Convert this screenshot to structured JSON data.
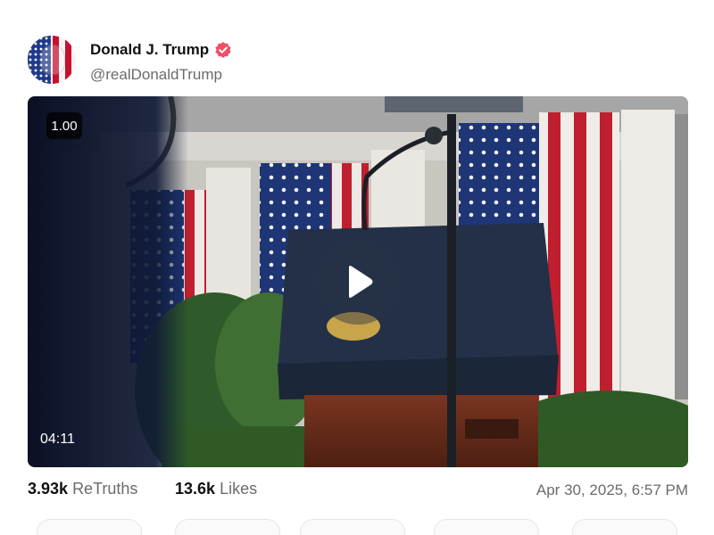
{
  "post": {
    "author": {
      "display_name": "Donald J. Trump",
      "handle": "@realDonaldTrump",
      "verified": true,
      "avatar_icon": "flag-portrait-avatar",
      "verified_icon": "verified-badge-icon",
      "verified_color": "#ef4f66"
    },
    "video": {
      "speed": "1.00",
      "duration": "04:11",
      "play_icon": "play-icon"
    },
    "stats": {
      "retruths_count": "3.93k",
      "retruths_label": "ReTruths",
      "likes_count": "13.6k",
      "likes_label": "Likes",
      "timestamp": "Apr 30, 2025, 6:57 PM"
    }
  }
}
